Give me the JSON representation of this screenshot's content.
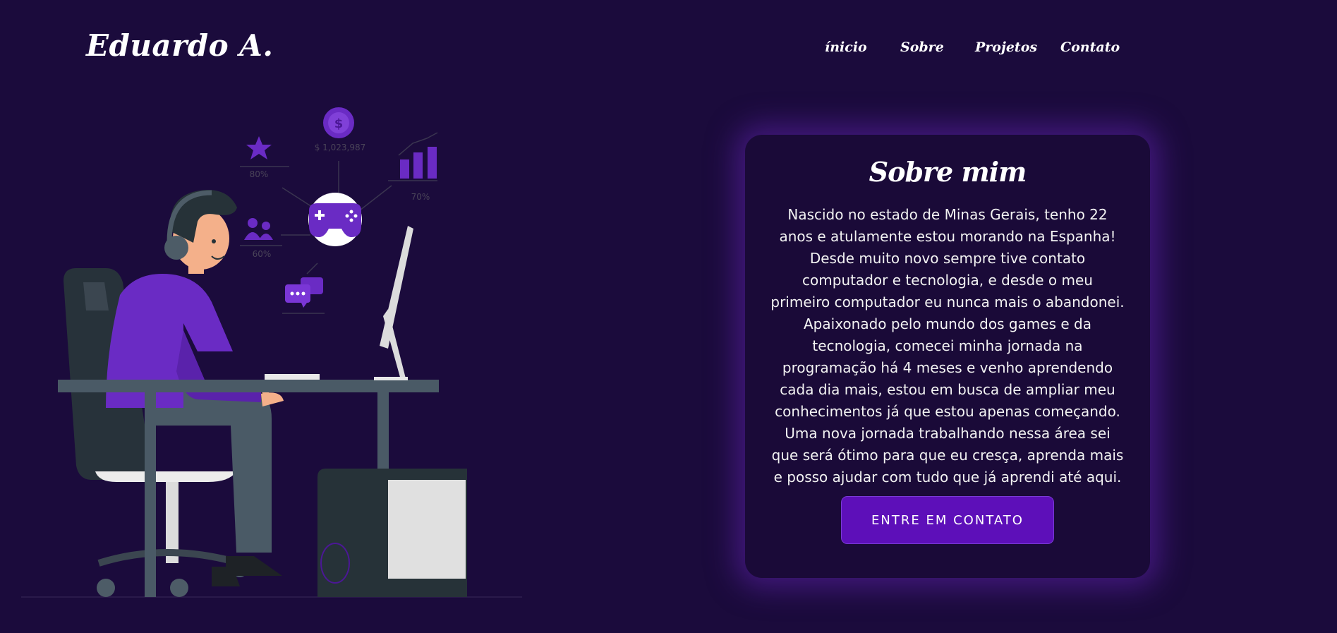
{
  "header": {
    "logo": "Eduardo A.",
    "nav": [
      "ínicio",
      "Sobre",
      "Projetos",
      "Contato"
    ]
  },
  "illustration": {
    "money_label": "$ 1,023,987",
    "star_label": "80%",
    "chart_label": "70%",
    "people_label": "60%"
  },
  "about": {
    "title": "Sobre mim",
    "text": "Nascido no estado de Minas Gerais, tenho 22 anos e atulamente estou morando na Espanha! Desde muito novo sempre tive contato computador e tecnologia, e desde o meu primeiro computador eu nunca mais o abandonei. Apaixonado pelo mundo dos games e da tecnologia, comecei minha jornada na programação há 4 meses e venho aprendendo cada dia mais, estou em busca de ampliar meu conhecimentos já que estou apenas começando. Uma nova jornada trabalhando nessa área sei que será ótimo para que eu cresça, aprenda mais e posso ajudar com tudo que já aprendi até aqui.",
    "button": "ENTRE EM CONTATO"
  },
  "colors": {
    "background": "#1b0b3c",
    "card": "#1a0a38",
    "accent": "#5d0fb9",
    "purple": "#6a2bc4"
  }
}
